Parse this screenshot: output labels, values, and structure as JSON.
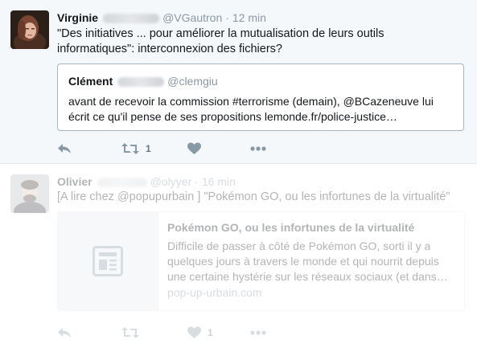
{
  "colors": {
    "text": "#14171a",
    "muted": "#8b98a5",
    "action_icon": "#8899a6",
    "selected_background": "#f5f8fa",
    "quote_border": "#a7b5bf",
    "card_border": "#e1e8ed"
  },
  "tweets": [
    {
      "name": "Virginie",
      "handle": "@VGautron",
      "separator": "·",
      "time": "12 min",
      "text": "\"Des initiatives ... pour améliorer la mutualisation de leurs outils informatiques\": interconnexion des fichiers?",
      "quote": {
        "name": "Clément",
        "handle": "@clemgiu",
        "text": "avant de recevoir la commission #terrorisme (demain), @BCazeneuve lui écrit ce qu'il pense de ses propositions lemonde.fr/police-justice…"
      },
      "actions": {
        "reply_icon": "reply-icon",
        "retweet_icon": "retweet-icon",
        "retweet_count": "1",
        "like_icon": "heart-icon",
        "like_count": "",
        "more_icon": "more-icon"
      }
    },
    {
      "name": "Olivier",
      "handle": "@olyyer",
      "separator": "·",
      "time": "16 min",
      "text": "[A lire chez @popupurbain ] \"Pokémon GO, ou les infortunes de la virtualité\"",
      "card": {
        "title": "Pokémon GO, ou les infortunes de la virtualité",
        "description": "Difficile de passer à côté de Pokémon GO, sorti il y a quelques jours à travers le monde et qui nourrit depuis une certaine hystérie sur les réseaux sociaux (et dans…",
        "domain": "pop-up-urbain.com",
        "thumb_icon": "document-icon"
      },
      "actions": {
        "reply_icon": "reply-icon",
        "retweet_icon": "retweet-icon",
        "retweet_count": "",
        "like_icon": "heart-icon",
        "like_count": "1",
        "more_icon": "more-icon"
      }
    }
  ]
}
